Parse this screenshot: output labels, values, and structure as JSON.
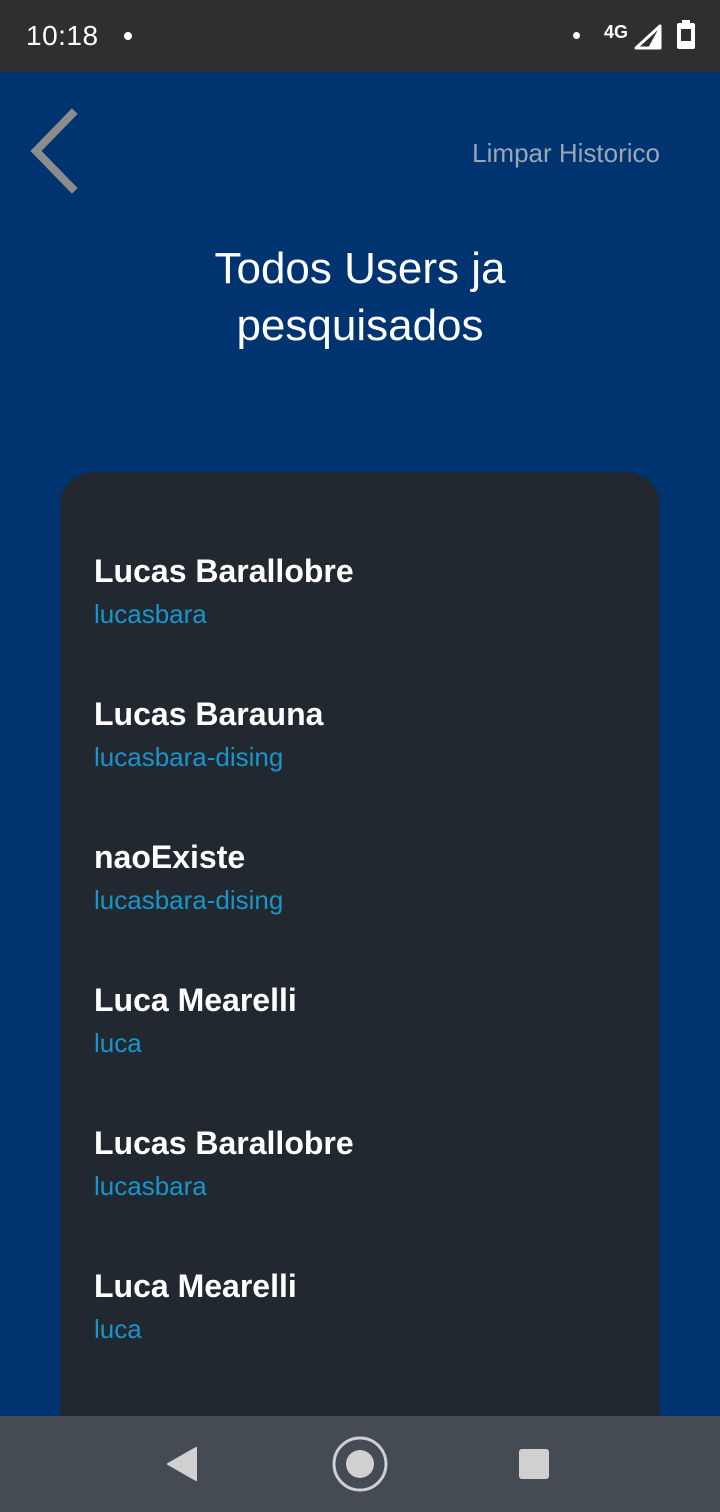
{
  "status_bar": {
    "time": "10:18",
    "network": "4G",
    "icons": [
      "notification-dot-icon",
      "signal-icon",
      "battery-icon"
    ]
  },
  "header": {
    "back_icon": "chevron-left-icon",
    "clear_label": "Limpar Historico",
    "title": "Todos Users ja pesquisados"
  },
  "history": [
    {
      "name": "Lucas Barallobre",
      "login": "lucasbara"
    },
    {
      "name": "Lucas Barauna",
      "login": "lucasbara-dising"
    },
    {
      "name": "naoExiste",
      "login": "lucasbara-dising"
    },
    {
      "name": "Luca Mearelli",
      "login": "luca"
    },
    {
      "name": "Lucas Barallobre",
      "login": "lucasbara"
    },
    {
      "name": "Luca Mearelli",
      "login": "luca"
    }
  ],
  "nav_bar": {
    "icons": [
      "nav-back-icon",
      "nav-home-icon",
      "nav-recents-icon"
    ]
  },
  "colors": {
    "background": "#003470",
    "card": "#212830",
    "accent": "#1a95c9",
    "status_bar": "#2f2f2f",
    "nav_bar": "#444b52"
  }
}
